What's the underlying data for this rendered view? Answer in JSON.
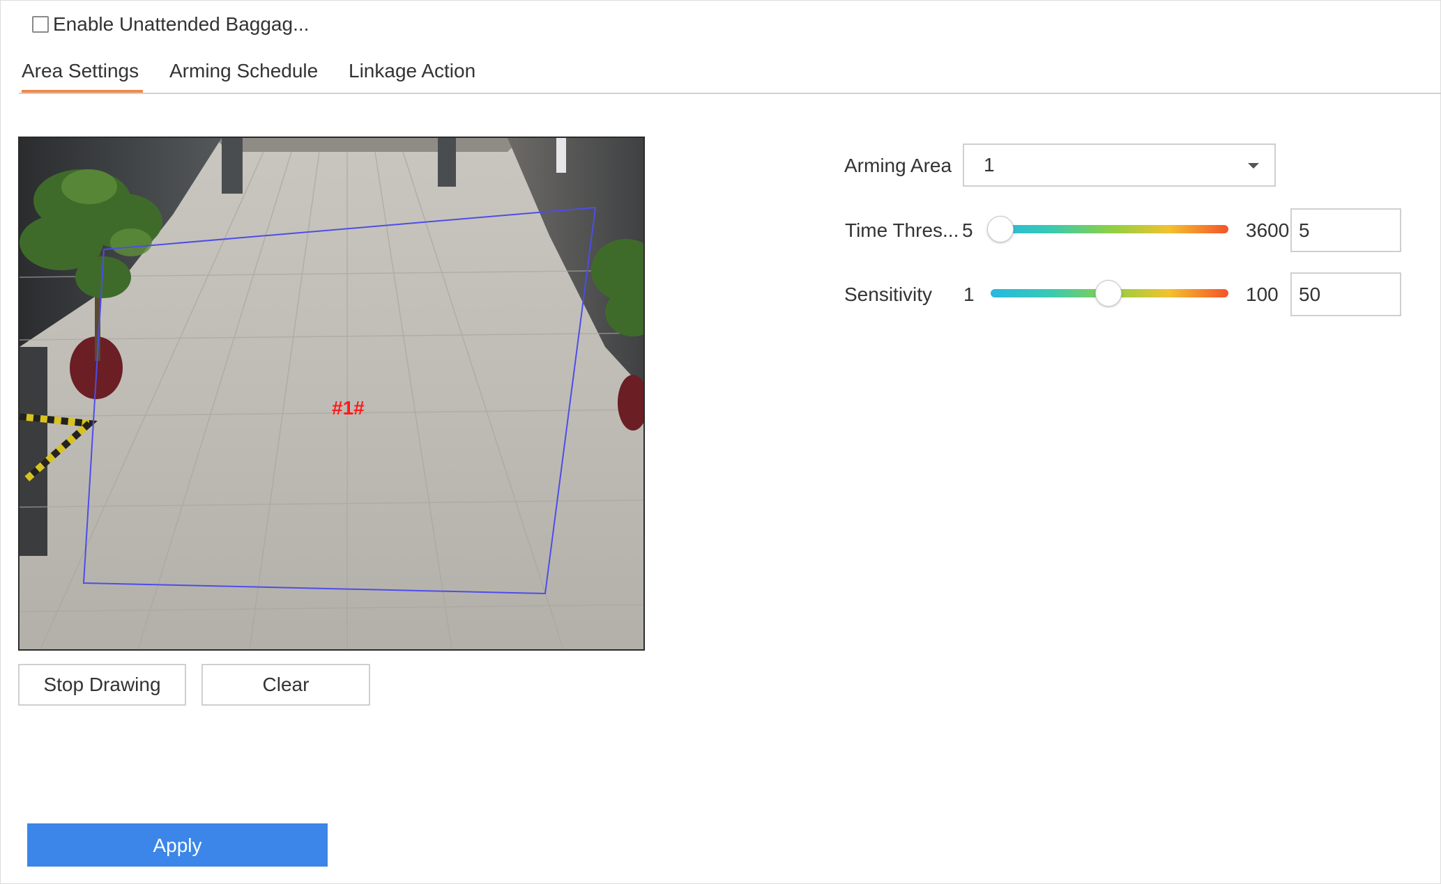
{
  "enable": {
    "label": "Enable Unattended Baggag...",
    "checked": false
  },
  "tabs": [
    {
      "label": "Area Settings",
      "active": true
    },
    {
      "label": "Arming Schedule",
      "active": false
    },
    {
      "label": "Linkage Action",
      "active": false
    }
  ],
  "video": {
    "area_label": "#1#"
  },
  "buttons": {
    "stop_drawing": "Stop Drawing",
    "clear": "Clear",
    "apply": "Apply"
  },
  "settings": {
    "arming_area": {
      "label": "Arming Area",
      "value": "1"
    },
    "time_threshold": {
      "label": "Time Thres...",
      "min": "5",
      "max": "3600",
      "value": "5",
      "min_num": 5,
      "max_num": 3600,
      "value_num": 5
    },
    "sensitivity": {
      "label": "Sensitivity",
      "min": "1",
      "max": "100",
      "value": "50",
      "min_num": 1,
      "max_num": 100,
      "value_num": 50
    }
  },
  "colors": {
    "accent_tab": "#f08a4b",
    "apply_button": "#3b86e8",
    "area_outline": "#4d4de8",
    "area_label": "#ff1a1a"
  },
  "icons": {
    "dropdown": "chevron-down-icon",
    "checkbox": "checkbox-unchecked-icon"
  }
}
